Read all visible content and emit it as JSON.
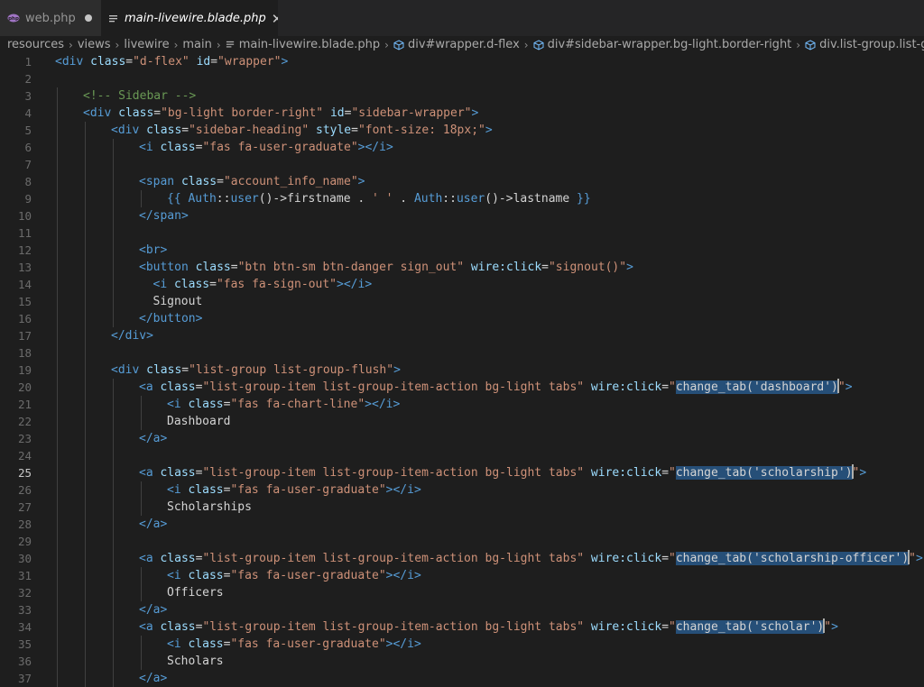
{
  "tabs": [
    {
      "label": "web.php",
      "icon": "php-icon",
      "modified": true,
      "active": false
    },
    {
      "label": "main-livewire.blade.php",
      "icon": "file-lines-icon",
      "active": true
    }
  ],
  "breadcrumb": [
    {
      "label": "resources",
      "icon": ""
    },
    {
      "label": "views",
      "icon": ""
    },
    {
      "label": "livewire",
      "icon": ""
    },
    {
      "label": "main",
      "icon": ""
    },
    {
      "label": "main-livewire.blade.php",
      "icon": "file-lines-icon"
    },
    {
      "label": "div#wrapper.d-flex",
      "icon": "cube-icon"
    },
    {
      "label": "div#sidebar-wrapper.bg-light.border-right",
      "icon": "cube-icon"
    },
    {
      "label": "div.list-group.list-group-flush",
      "icon": "cube-icon"
    }
  ],
  "editor": {
    "current_line": 25,
    "lines": [
      {
        "n": "1",
        "indent": 0,
        "tokens": [
          [
            "tg",
            "<div "
          ],
          [
            "at",
            "class"
          ],
          [
            "pl",
            "="
          ],
          [
            "st",
            "\"d-flex\""
          ],
          [
            "pl",
            " "
          ],
          [
            "at",
            "id"
          ],
          [
            "pl",
            "="
          ],
          [
            "st",
            "\"wrapper\""
          ],
          [
            "tg",
            ">"
          ]
        ]
      },
      {
        "n": "2",
        "indent": 0,
        "tokens": []
      },
      {
        "n": "3",
        "indent": 1,
        "tokens": [
          [
            "cm",
            "<!-- Sidebar -->"
          ]
        ]
      },
      {
        "n": "4",
        "indent": 1,
        "tokens": [
          [
            "tg",
            "<div "
          ],
          [
            "at",
            "class"
          ],
          [
            "pl",
            "="
          ],
          [
            "st",
            "\"bg-light border-right\""
          ],
          [
            "pl",
            " "
          ],
          [
            "at",
            "id"
          ],
          [
            "pl",
            "="
          ],
          [
            "st",
            "\"sidebar-wrapper\""
          ],
          [
            "tg",
            ">"
          ]
        ]
      },
      {
        "n": "5",
        "indent": 2,
        "tokens": [
          [
            "tg",
            "<div "
          ],
          [
            "at",
            "class"
          ],
          [
            "pl",
            "="
          ],
          [
            "st",
            "\"sidebar-heading\""
          ],
          [
            "pl",
            " "
          ],
          [
            "at",
            "style"
          ],
          [
            "pl",
            "="
          ],
          [
            "st",
            "\"font-size: 18px;\""
          ],
          [
            "tg",
            ">"
          ]
        ]
      },
      {
        "n": "6",
        "indent": 3,
        "tokens": [
          [
            "tg",
            "<i "
          ],
          [
            "at",
            "class"
          ],
          [
            "pl",
            "="
          ],
          [
            "st",
            "\"fas fa-user-graduate\""
          ],
          [
            "tg",
            "></i>"
          ]
        ]
      },
      {
        "n": "7",
        "indent": 3,
        "tokens": []
      },
      {
        "n": "8",
        "indent": 3,
        "tokens": [
          [
            "tg",
            "<span "
          ],
          [
            "at",
            "class"
          ],
          [
            "pl",
            "="
          ],
          [
            "st",
            "\"account_info_name\""
          ],
          [
            "tg",
            ">"
          ]
        ]
      },
      {
        "n": "9",
        "indent": 4,
        "tokens": [
          [
            "tg",
            "{{ "
          ],
          [
            "tg",
            "Auth"
          ],
          [
            "pl",
            "::"
          ],
          [
            "tg",
            "user"
          ],
          [
            "pl",
            "()->"
          ],
          [
            "pl",
            "firstname . "
          ],
          [
            "st",
            "' '"
          ],
          [
            "pl",
            " . "
          ],
          [
            "tg",
            "Auth"
          ],
          [
            "pl",
            "::"
          ],
          [
            "tg",
            "user"
          ],
          [
            "pl",
            "()->"
          ],
          [
            "pl",
            "lastname "
          ],
          [
            "tg",
            "}}"
          ]
        ]
      },
      {
        "n": "10",
        "indent": 3,
        "tokens": [
          [
            "tg",
            "</span>"
          ]
        ]
      },
      {
        "n": "11",
        "indent": 3,
        "tokens": []
      },
      {
        "n": "12",
        "indent": 3,
        "tokens": [
          [
            "tg",
            "<br>"
          ]
        ]
      },
      {
        "n": "13",
        "indent": 3,
        "tokens": [
          [
            "tg",
            "<button "
          ],
          [
            "at",
            "class"
          ],
          [
            "pl",
            "="
          ],
          [
            "st",
            "\"btn btn-sm btn-danger sign_out\""
          ],
          [
            "pl",
            " "
          ],
          [
            "at",
            "wire:click"
          ],
          [
            "pl",
            "="
          ],
          [
            "st",
            "\"signout()\""
          ],
          [
            "tg",
            ">"
          ]
        ]
      },
      {
        "n": "14",
        "indent": 3.5,
        "tokens": [
          [
            "tg",
            "<i "
          ],
          [
            "at",
            "class"
          ],
          [
            "pl",
            "="
          ],
          [
            "st",
            "\"fas fa-sign-out\""
          ],
          [
            "tg",
            "></i>"
          ]
        ]
      },
      {
        "n": "15",
        "indent": 3.5,
        "tokens": [
          [
            "pl",
            "Signout"
          ]
        ]
      },
      {
        "n": "16",
        "indent": 3,
        "tokens": [
          [
            "tg",
            "</button>"
          ]
        ]
      },
      {
        "n": "17",
        "indent": 2,
        "tokens": [
          [
            "tg",
            "</div>"
          ]
        ]
      },
      {
        "n": "18",
        "indent": 2,
        "tokens": []
      },
      {
        "n": "19",
        "indent": 2,
        "tokens": [
          [
            "tg",
            "<div "
          ],
          [
            "at",
            "class"
          ],
          [
            "pl",
            "="
          ],
          [
            "st",
            "\"list-group list-group-flush\""
          ],
          [
            "tg",
            ">"
          ]
        ]
      },
      {
        "n": "20",
        "indent": 3,
        "tokens": [
          [
            "tg",
            "<a "
          ],
          [
            "at",
            "class"
          ],
          [
            "pl",
            "="
          ],
          [
            "st",
            "\"list-group-item list-group-item-action bg-light tabs\""
          ],
          [
            "pl",
            " "
          ],
          [
            "at",
            "wire:click"
          ],
          [
            "pl",
            "="
          ],
          [
            "st",
            "\""
          ],
          [
            "hl",
            "change_tab('dashboard')"
          ],
          [
            "caret",
            ""
          ],
          [
            "st",
            "\""
          ],
          [
            "tg",
            ">"
          ]
        ]
      },
      {
        "n": "21",
        "indent": 4,
        "tokens": [
          [
            "tg",
            "<i "
          ],
          [
            "at",
            "class"
          ],
          [
            "pl",
            "="
          ],
          [
            "st",
            "\"fas fa-chart-line\""
          ],
          [
            "tg",
            "></i>"
          ]
        ]
      },
      {
        "n": "22",
        "indent": 4,
        "tokens": [
          [
            "pl",
            "Dashboard"
          ]
        ]
      },
      {
        "n": "23",
        "indent": 3,
        "tokens": [
          [
            "tg",
            "</a>"
          ]
        ]
      },
      {
        "n": "24",
        "indent": 3,
        "tokens": []
      },
      {
        "n": "25",
        "indent": 3,
        "tokens": [
          [
            "tg",
            "<a "
          ],
          [
            "at",
            "class"
          ],
          [
            "pl",
            "="
          ],
          [
            "st",
            "\"list-group-item list-group-item-action bg-light tabs\""
          ],
          [
            "pl",
            " "
          ],
          [
            "at",
            "wire:click"
          ],
          [
            "pl",
            "="
          ],
          [
            "st",
            "\""
          ],
          [
            "hl",
            "change_tab('scholarship')"
          ],
          [
            "caret",
            ""
          ],
          [
            "st",
            "\""
          ],
          [
            "tg",
            ">"
          ]
        ]
      },
      {
        "n": "26",
        "indent": 4,
        "tokens": [
          [
            "tg",
            "<i "
          ],
          [
            "at",
            "class"
          ],
          [
            "pl",
            "="
          ],
          [
            "st",
            "\"fas fa-user-graduate\""
          ],
          [
            "tg",
            "></i>"
          ]
        ]
      },
      {
        "n": "27",
        "indent": 4,
        "tokens": [
          [
            "pl",
            "Scholarships"
          ]
        ]
      },
      {
        "n": "28",
        "indent": 3,
        "tokens": [
          [
            "tg",
            "</a>"
          ]
        ]
      },
      {
        "n": "29",
        "indent": 3,
        "tokens": []
      },
      {
        "n": "30",
        "indent": 3,
        "tokens": [
          [
            "tg",
            "<a "
          ],
          [
            "at",
            "class"
          ],
          [
            "pl",
            "="
          ],
          [
            "st",
            "\"list-group-item list-group-item-action bg-light tabs\""
          ],
          [
            "pl",
            " "
          ],
          [
            "at",
            "wire:click"
          ],
          [
            "pl",
            "="
          ],
          [
            "st",
            "\""
          ],
          [
            "hl",
            "change_tab('scholarship-officer')"
          ],
          [
            "caret",
            ""
          ],
          [
            "st",
            "\""
          ],
          [
            "tg",
            ">"
          ]
        ]
      },
      {
        "n": "31",
        "indent": 4,
        "tokens": [
          [
            "tg",
            "<i "
          ],
          [
            "at",
            "class"
          ],
          [
            "pl",
            "="
          ],
          [
            "st",
            "\"fas fa-user-graduate\""
          ],
          [
            "tg",
            "></i>"
          ]
        ]
      },
      {
        "n": "32",
        "indent": 4,
        "tokens": [
          [
            "pl",
            "Officers"
          ]
        ]
      },
      {
        "n": "33",
        "indent": 3,
        "tokens": [
          [
            "tg",
            "</a>"
          ]
        ]
      },
      {
        "n": "34",
        "indent": 3,
        "tokens": [
          [
            "tg",
            "<a "
          ],
          [
            "at",
            "class"
          ],
          [
            "pl",
            "="
          ],
          [
            "st",
            "\"list-group-item list-group-item-action bg-light tabs\""
          ],
          [
            "pl",
            " "
          ],
          [
            "at",
            "wire:click"
          ],
          [
            "pl",
            "="
          ],
          [
            "st",
            "\""
          ],
          [
            "hl",
            "change_tab('scholar')"
          ],
          [
            "caret",
            ""
          ],
          [
            "st",
            "\""
          ],
          [
            "tg",
            ">"
          ]
        ]
      },
      {
        "n": "35",
        "indent": 4,
        "tokens": [
          [
            "tg",
            "<i "
          ],
          [
            "at",
            "class"
          ],
          [
            "pl",
            "="
          ],
          [
            "st",
            "\"fas fa-user-graduate\""
          ],
          [
            "tg",
            "></i>"
          ]
        ]
      },
      {
        "n": "36",
        "indent": 4,
        "tokens": [
          [
            "pl",
            "Scholars"
          ]
        ]
      },
      {
        "n": "37",
        "indent": 3,
        "tokens": [
          [
            "tg",
            "</a>"
          ]
        ]
      }
    ]
  }
}
